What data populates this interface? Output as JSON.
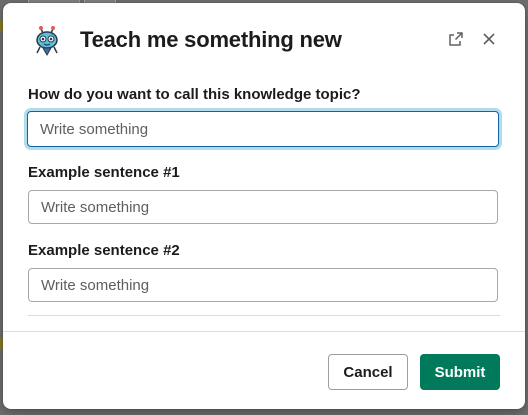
{
  "modal": {
    "title": "Teach me something new",
    "icon": "robot-bot-icon",
    "header_icons": [
      "open-external-icon",
      "close-icon"
    ]
  },
  "form": {
    "topic": {
      "label": "How do you want to call this knowledge topic?",
      "placeholder": "Write something",
      "value": ""
    },
    "example1": {
      "label": "Example sentence #1",
      "placeholder": "Write something",
      "value": ""
    },
    "example2": {
      "label": "Example sentence #2",
      "placeholder": "Write something",
      "value": ""
    }
  },
  "footer": {
    "cancel_label": "Cancel",
    "submit_label": "Submit"
  },
  "colors": {
    "submit": "#007a5a",
    "focus_ring": "#1264a3",
    "text": "#1d1c1d"
  }
}
